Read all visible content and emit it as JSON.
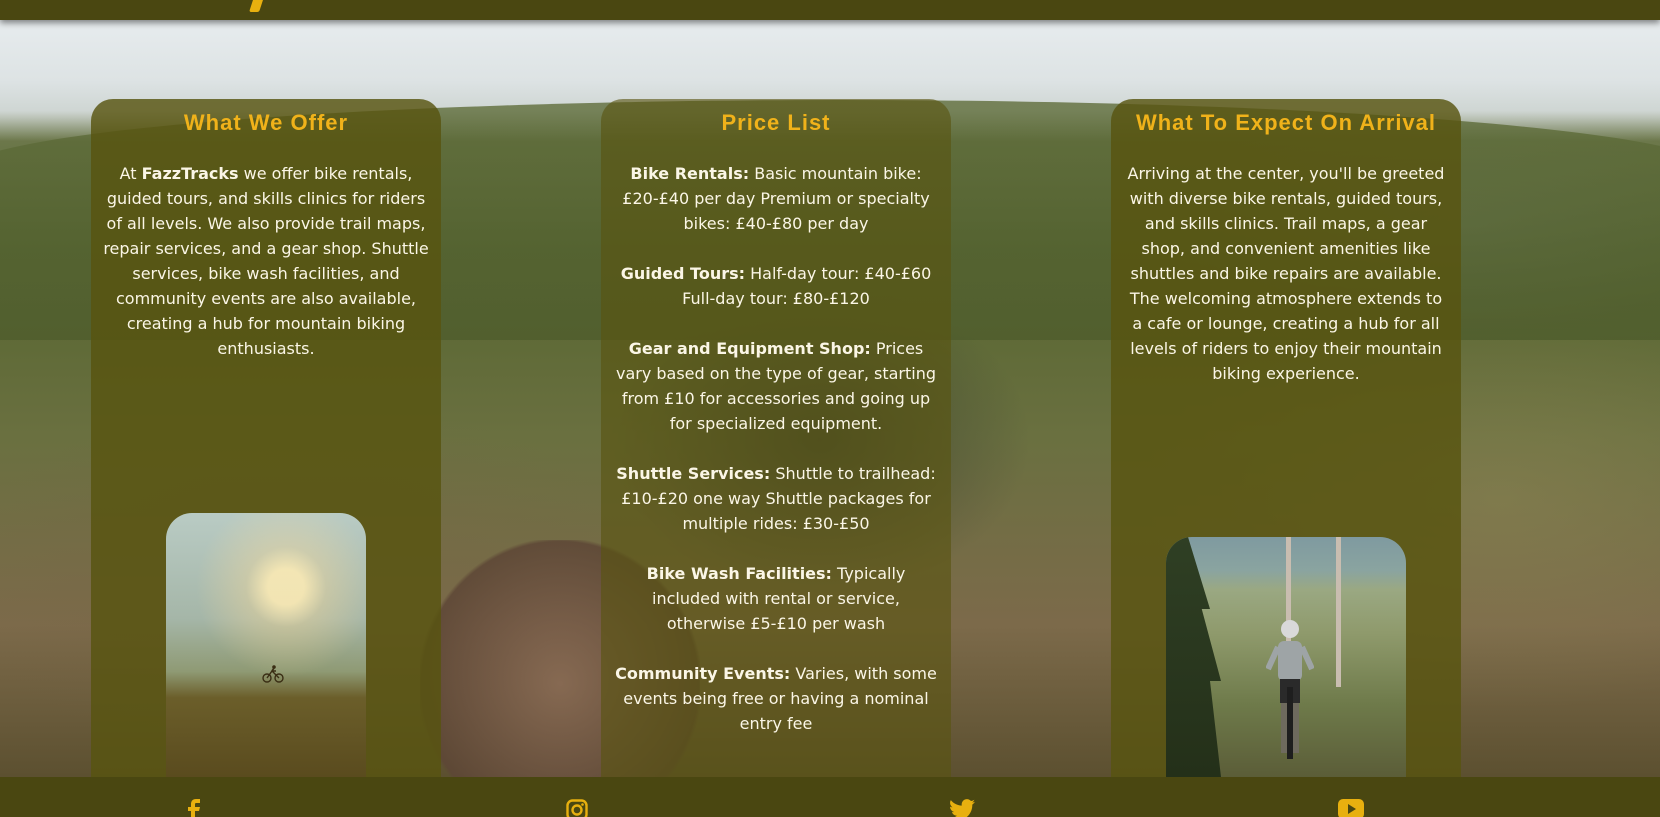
{
  "brand": {
    "accent": "#f0b21a",
    "bar": "#4a4711"
  },
  "offer": {
    "title": "What We Offer",
    "intro": "At ",
    "brand_name": "FazzTracks",
    "text": " we offer bike rentals, guided tours, and skills clinics for riders of all levels. We also provide trail maps, repair services, and a gear shop. Shuttle services, bike wash facilities, and community events are also available, creating a hub for mountain biking enthusiasts.",
    "image_icon": "mountain-bike-sunset-photo"
  },
  "price": {
    "title": "Price List",
    "items": [
      {
        "label": "Bike Rentals:",
        "text": " Basic mountain bike: £20-£40 per day Premium or specialty bikes: £40-£80 per day"
      },
      {
        "label": "Guided Tours:",
        "text": " Half-day tour: £40-£60 Full-day tour: £80-£120"
      },
      {
        "label": "Gear and Equipment Shop:",
        "text": " Prices vary based on the type of gear, starting from £10 for accessories and going up for specialized equipment."
      },
      {
        "label": "Shuttle Services:",
        "text": " Shuttle to trailhead: £10-£20 one way Shuttle packages for multiple rides: £30-£50"
      },
      {
        "label": "Bike Wash Facilities:",
        "text": " Typically included with rental or service, otherwise £5-£10 per wash"
      },
      {
        "label": "Community Events:",
        "text": " Varies, with some events being free or having a nominal entry fee"
      }
    ]
  },
  "arrival": {
    "title": "What To Expect On Arrival",
    "text": "Arriving at the center, you'll be greeted with diverse bike rentals, guided tours, and skills clinics. Trail maps, a gear shop, and convenient amenities like shuttles and bike repairs are available. The welcoming atmosphere extends to a cafe or lounge, creating a hub for all levels of riders to enjoy their mountain biking experience.",
    "image_icon": "rider-thumbs-up-photo"
  },
  "footer": {
    "icons": [
      "facebook-icon",
      "instagram-icon",
      "twitter-icon",
      "youtube-icon"
    ]
  }
}
